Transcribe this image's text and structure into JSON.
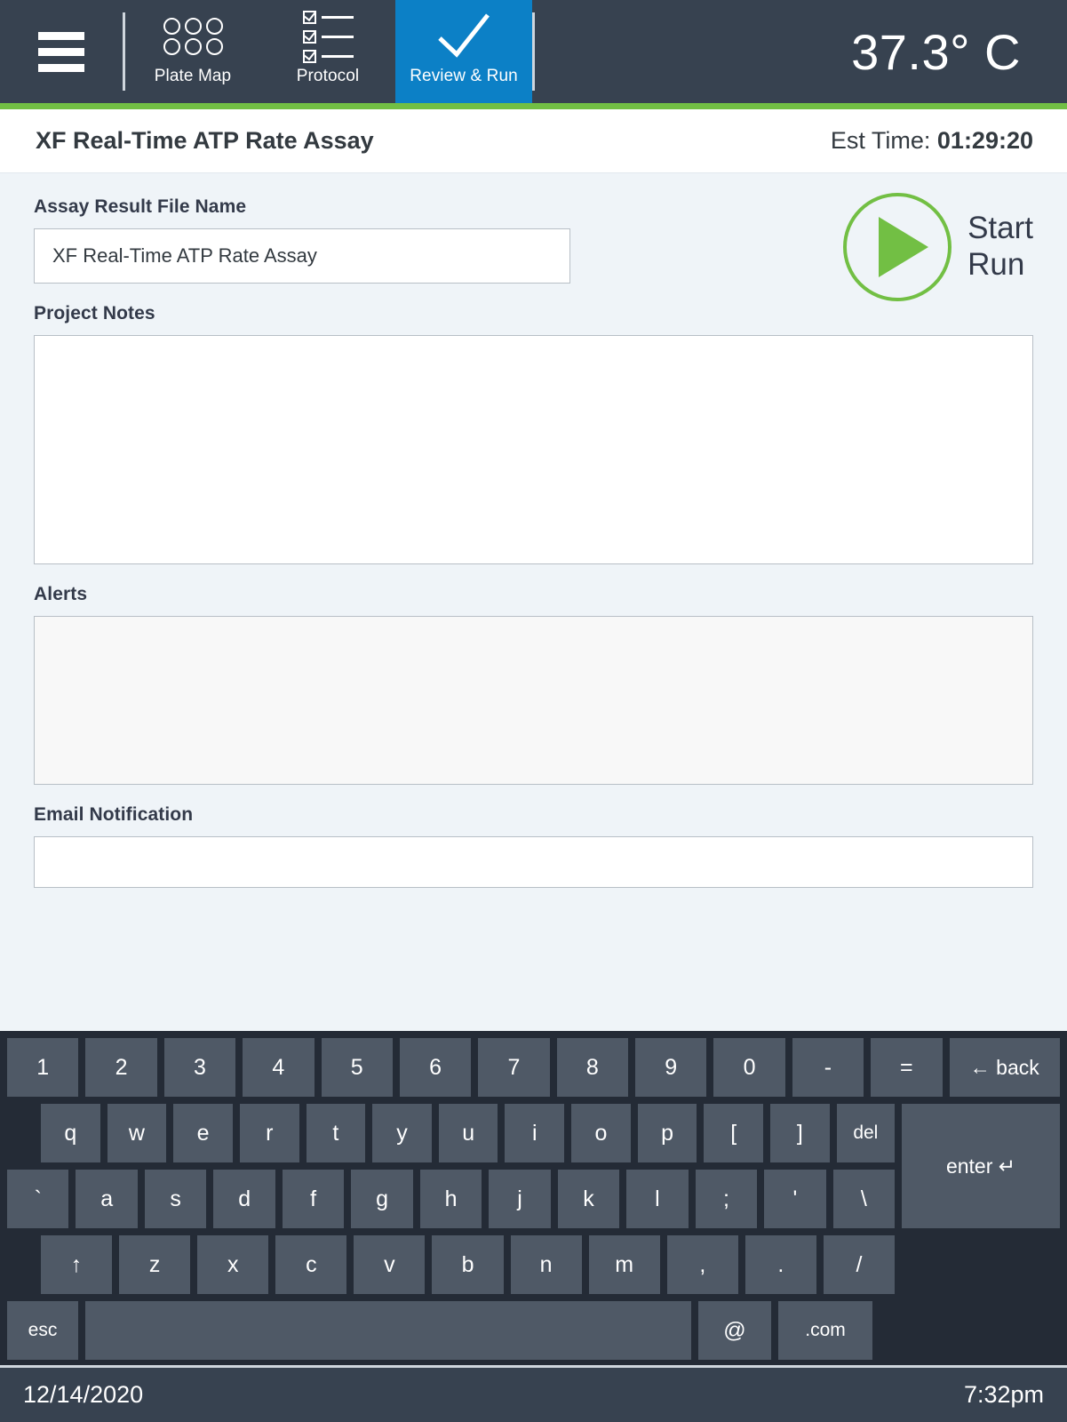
{
  "topnav": {
    "menu_icon": "hamburger-menu-icon",
    "tabs": [
      {
        "label": "Plate Map",
        "icon": "plate-map-icon",
        "active": false
      },
      {
        "label": "Protocol",
        "icon": "protocol-checklist-icon",
        "active": false
      },
      {
        "label": "Review & Run",
        "icon": "checkmark-icon",
        "active": true
      }
    ],
    "temperature": "37.3° C",
    "active_color": "#0c80c6",
    "bar_color": "#374250",
    "accent_green": "#72bf44"
  },
  "titlebar": {
    "assay_title": "XF Real-Time ATP Rate Assay",
    "est_time_label": "Est Time:",
    "est_time_value": "01:29:20"
  },
  "form": {
    "file_name_label": "Assay Result File Name",
    "file_name_value": "XF Real-Time ATP Rate Assay",
    "project_notes_label": "Project Notes",
    "project_notes_value": "",
    "alerts_label": "Alerts",
    "alerts_value": "",
    "email_label": "Email Notification",
    "email_value": ""
  },
  "start_run": {
    "line1": "Start",
    "line2": "Run",
    "icon": "play-icon",
    "color": "#72bf44"
  },
  "keyboard": {
    "row1": [
      "1",
      "2",
      "3",
      "4",
      "5",
      "6",
      "7",
      "8",
      "9",
      "0",
      "-",
      "=",
      "← back"
    ],
    "row2": [
      "q",
      "w",
      "e",
      "r",
      "t",
      "y",
      "u",
      "i",
      "o",
      "p",
      "[",
      "]",
      "del"
    ],
    "row3": [
      "`",
      "a",
      "s",
      "d",
      "f",
      "g",
      "h",
      "j",
      "k",
      "l",
      ";",
      "'",
      "\\"
    ],
    "row4": [
      "↑",
      "z",
      "x",
      "c",
      "v",
      "b",
      "n",
      "m",
      ",",
      ".",
      "/"
    ],
    "row5": [
      "esc",
      "",
      "@",
      ".com"
    ],
    "enter": "enter ↵",
    "space_label": ""
  },
  "statusbar": {
    "date": "12/14/2020",
    "time": "7:32pm"
  }
}
